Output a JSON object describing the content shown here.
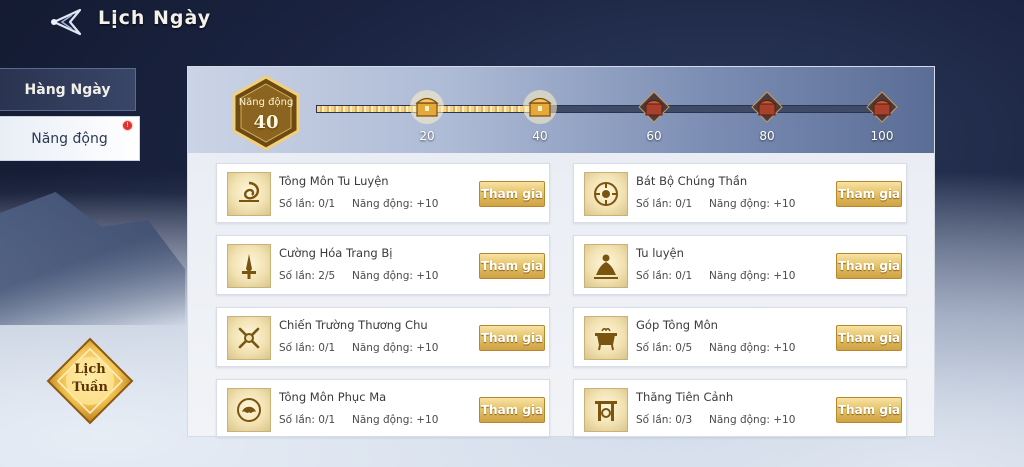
{
  "header": {
    "title": "Lịch Ngày"
  },
  "tabs": [
    {
      "label": "Hàng Ngày",
      "active": false
    },
    {
      "label": "Năng động",
      "active": true
    }
  ],
  "weekly_button": {
    "label_line1": "Lịch",
    "label_line2": "Tuần"
  },
  "activity": {
    "label": "Năng động",
    "value": "40",
    "progress_fraction": 0.4,
    "milestones": [
      {
        "label": "20",
        "unlocked": true
      },
      {
        "label": "40",
        "unlocked": true
      },
      {
        "label": "60",
        "unlocked": false
      },
      {
        "label": "80",
        "unlocked": false
      },
      {
        "label": "100",
        "unlocked": false
      }
    ]
  },
  "cards": [
    {
      "name": "Tông Môn Tu Luyện",
      "count": "Số lần: 0/1",
      "points": "Năng động: +10",
      "button": "Tham gia",
      "icon": "swirl-icon"
    },
    {
      "name": "Bát Bộ Chúng Thần",
      "count": "Số lần: 0/1",
      "points": "Năng động: +10",
      "button": "Tham gia",
      "icon": "lotus-icon"
    },
    {
      "name": "Cường Hóa Trang Bị",
      "count": "Số lần: 2/5",
      "points": "Năng động: +10",
      "button": "Tham gia",
      "icon": "sword-icon"
    },
    {
      "name": "Tu luyện",
      "count": "Số lần: 0/1",
      "points": "Năng động: +10",
      "button": "Tham gia",
      "icon": "meditation-icon"
    },
    {
      "name": "Chiến Trường Thương Chu",
      "count": "Số lần: 0/1",
      "points": "Năng động: +10",
      "button": "Tham gia",
      "icon": "crossed-weapons-icon"
    },
    {
      "name": "Góp Tông Môn",
      "count": "Số lần: 0/5",
      "points": "Năng động: +10",
      "button": "Tham gia",
      "icon": "cauldron-icon"
    },
    {
      "name": "Tông Môn Phục Ma",
      "count": "Số lần: 0/1",
      "points": "Năng động: +10",
      "button": "Tham gia",
      "icon": "beast-icon"
    },
    {
      "name": "Thăng Tiên Cảnh",
      "count": "Số lần: 0/3",
      "points": "Năng động: +10",
      "button": "Tham gia",
      "icon": "gate-icon"
    }
  ]
}
